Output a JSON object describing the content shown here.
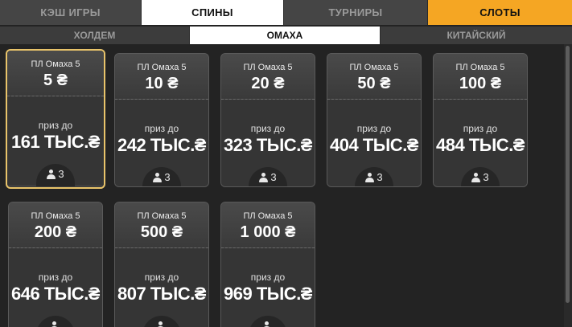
{
  "top_tabs": [
    {
      "label": "КЭШ ИГРЫ",
      "state": "inactive"
    },
    {
      "label": "СПИНЫ",
      "state": "active"
    },
    {
      "label": "ТУРНИРЫ",
      "state": "inactive"
    },
    {
      "label": "СЛОТЫ",
      "state": "accent"
    }
  ],
  "sub_tabs": [
    {
      "label": "ХОЛДЕМ",
      "state": "inactive"
    },
    {
      "label": "ОМАХА",
      "state": "active"
    },
    {
      "label": "КИТАЙСКИЙ",
      "state": "inactive"
    }
  ],
  "cards": [
    {
      "name": "ПЛ Омаха 5",
      "stake": "5 ₴",
      "prize_label": "приз до",
      "prize": "161 ТЫС.₴",
      "players": "3",
      "selected": true
    },
    {
      "name": "ПЛ Омаха 5",
      "stake": "10 ₴",
      "prize_label": "приз до",
      "prize": "242 ТЫС.₴",
      "players": "3"
    },
    {
      "name": "ПЛ Омаха 5",
      "stake": "20 ₴",
      "prize_label": "приз до",
      "prize": "323 ТЫС.₴",
      "players": "3"
    },
    {
      "name": "ПЛ Омаха 5",
      "stake": "50 ₴",
      "prize_label": "приз до",
      "prize": "404 ТЫС.₴",
      "players": "3"
    },
    {
      "name": "ПЛ Омаха 5",
      "stake": "100 ₴",
      "prize_label": "приз до",
      "prize": "484 ТЫС.₴",
      "players": "3"
    },
    {
      "name": "ПЛ Омаха 5",
      "stake": "200 ₴",
      "prize_label": "приз до",
      "prize": "646 ТЫС.₴",
      "players": ""
    },
    {
      "name": "ПЛ Омаха 5",
      "stake": "500 ₴",
      "prize_label": "приз до",
      "prize": "807 ТЫС.₴",
      "players": ""
    },
    {
      "name": "ПЛ Омаха 5",
      "stake": "1 000 ₴",
      "prize_label": "приз до",
      "prize": "969 ТЫС.₴",
      "players": ""
    }
  ],
  "colors": {
    "accent": "#f5a623",
    "selected_border": "#e9c46a",
    "background": "#232323"
  }
}
